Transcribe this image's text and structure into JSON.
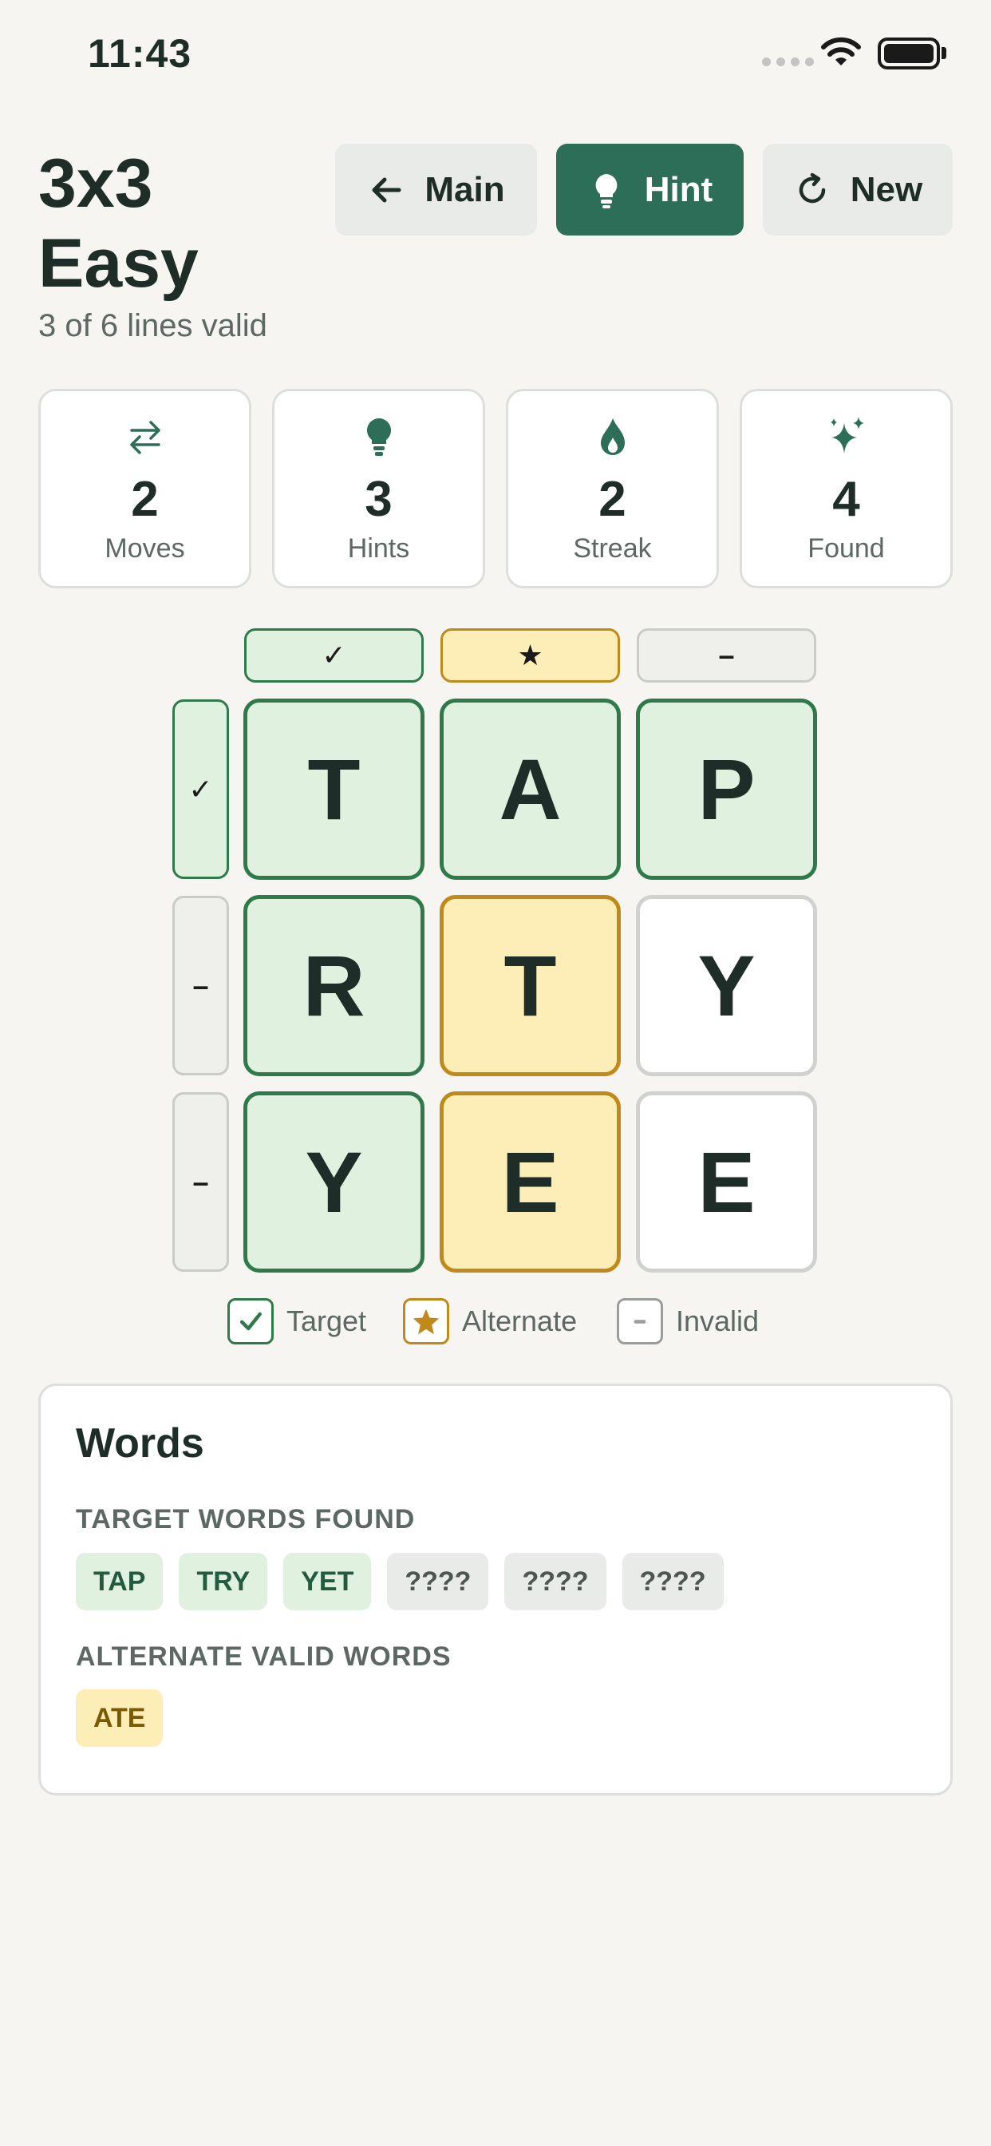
{
  "status_bar": {
    "time": "11:43"
  },
  "header": {
    "title_line1": "3x3",
    "title_line2": "Easy",
    "subtitle": "3 of 6 lines valid",
    "buttons": {
      "main": "Main",
      "hint": "Hint",
      "new": "New"
    }
  },
  "stats": [
    {
      "value": "2",
      "label": "Moves",
      "icon": "swap-arrows-icon"
    },
    {
      "value": "3",
      "label": "Hints",
      "icon": "lightbulb-icon"
    },
    {
      "value": "2",
      "label": "Streak",
      "icon": "flame-icon"
    },
    {
      "value": "4",
      "label": "Found",
      "icon": "sparkles-icon"
    }
  ],
  "grid": {
    "column_status": [
      "✓",
      "★",
      "–"
    ],
    "row_status": [
      "✓",
      "–",
      "–"
    ],
    "rows": [
      [
        "T",
        "A",
        "P"
      ],
      [
        "R",
        "T",
        "Y"
      ],
      [
        "Y",
        "E",
        "E"
      ]
    ]
  },
  "legend": {
    "target": "Target",
    "alternate": "Alternate",
    "invalid": "Invalid"
  },
  "words": {
    "title": "Words",
    "target_heading": "TARGET WORDS FOUND",
    "target_words": [
      "TAP",
      "TRY",
      "YET",
      "????",
      "????",
      "????"
    ],
    "alternate_heading": "ALTERNATE VALID WORDS",
    "alternate_words": [
      "ATE"
    ]
  },
  "colors": {
    "background": "#f6f5f1",
    "accent_dark_green": "#2d6e58",
    "target_fill": "#e0f2df",
    "target_border": "#2e7a4a",
    "alternate_fill": "#fdeeb7",
    "alternate_border": "#c08a1a",
    "invalid_fill": "#efefec"
  }
}
